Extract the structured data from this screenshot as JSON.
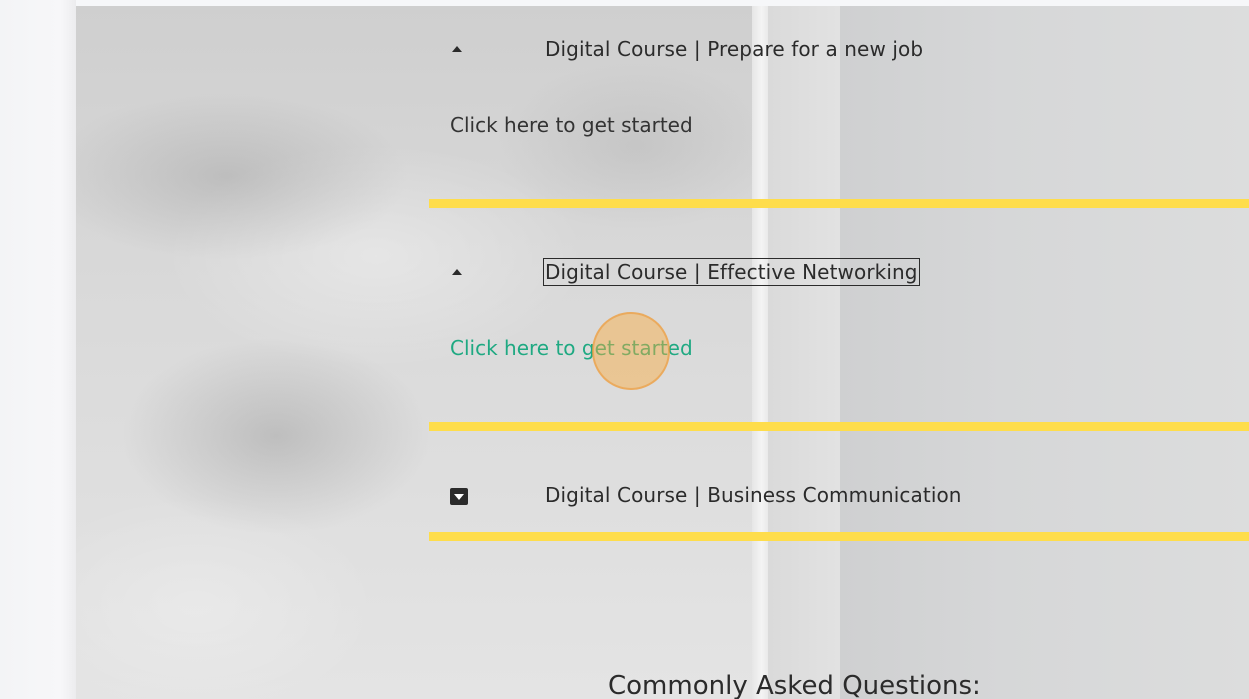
{
  "accordion": {
    "items": [
      {
        "title": "Digital Course | Prepare for a new job",
        "expanded": true,
        "link_label": "Click here to get started",
        "toggle_icon": "caret-up-icon"
      },
      {
        "title": "Digital Course | Effective Networking",
        "expanded": true,
        "link_label": "Click here to get started",
        "toggle_icon": "caret-up-icon",
        "focused": true,
        "link_hovered": true
      },
      {
        "title": "Digital Course | Business Communication",
        "expanded": false,
        "toggle_icon": "expand-box-icon"
      }
    ]
  },
  "faq": {
    "heading": "Commonly Asked Questions:"
  },
  "colors": {
    "divider": "#fedd4b",
    "link_hover": "#1fa982",
    "text": "#2b2b2b",
    "click_marker": "#faaa3c"
  }
}
